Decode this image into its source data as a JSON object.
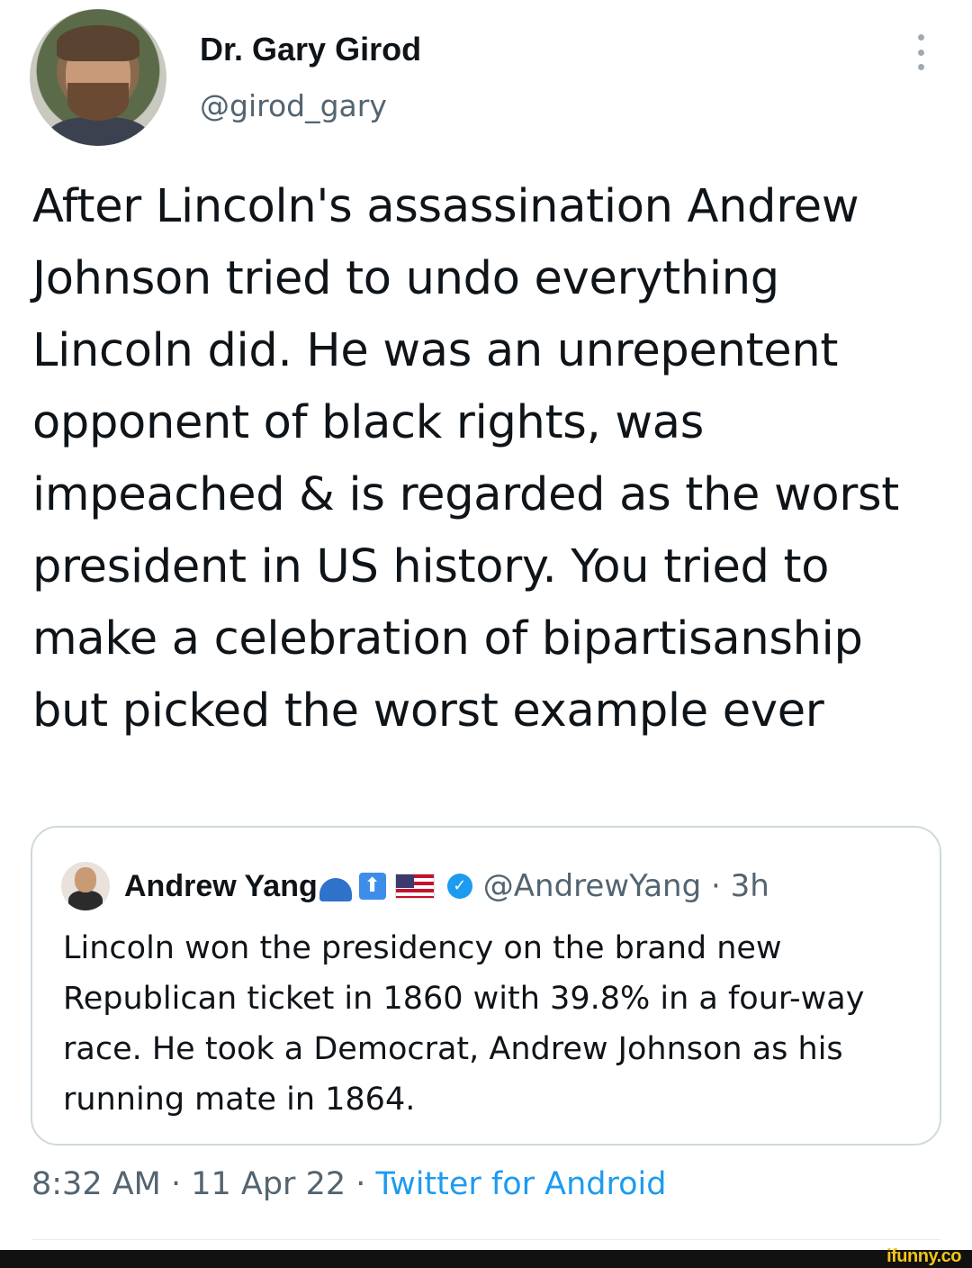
{
  "tweet": {
    "author": {
      "display_name": "Dr. Gary Girod",
      "handle": "@girod_gary"
    },
    "more_icon": "more-vertical-icon",
    "text": "After Lincoln's assassination Andrew Johnson tried to undo everything Lincoln did. He was an unrepentent opponent of black rights, was impeached & is regarded as the worst president in US history. You tried to make a celebration of bipartisanship but picked the worst example ever",
    "quoted": {
      "display_name": "Andrew Yang",
      "name_emojis": [
        "blue-cap-emoji",
        "up-arrow-emoji",
        "us-flag-emoji"
      ],
      "arrow_glyph": "⬆",
      "verified_glyph": "✓",
      "handle_time": "@AndrewYang · 3h",
      "text": "Lincoln won the presidency on the brand new Republican ticket in 1860 with 39.8% in a four-way race. He took a Democrat, Andrew Johnson as his running mate in 1864."
    },
    "time_date": "8:32 AM · 11 Apr 22 · ",
    "source": "Twitter for Android"
  },
  "watermark": "ifunny.co",
  "colors": {
    "text": "#0f1419",
    "secondary": "#536471",
    "link": "#1d9bf0",
    "border": "#cfd9de",
    "watermark": "#f2c41a"
  }
}
